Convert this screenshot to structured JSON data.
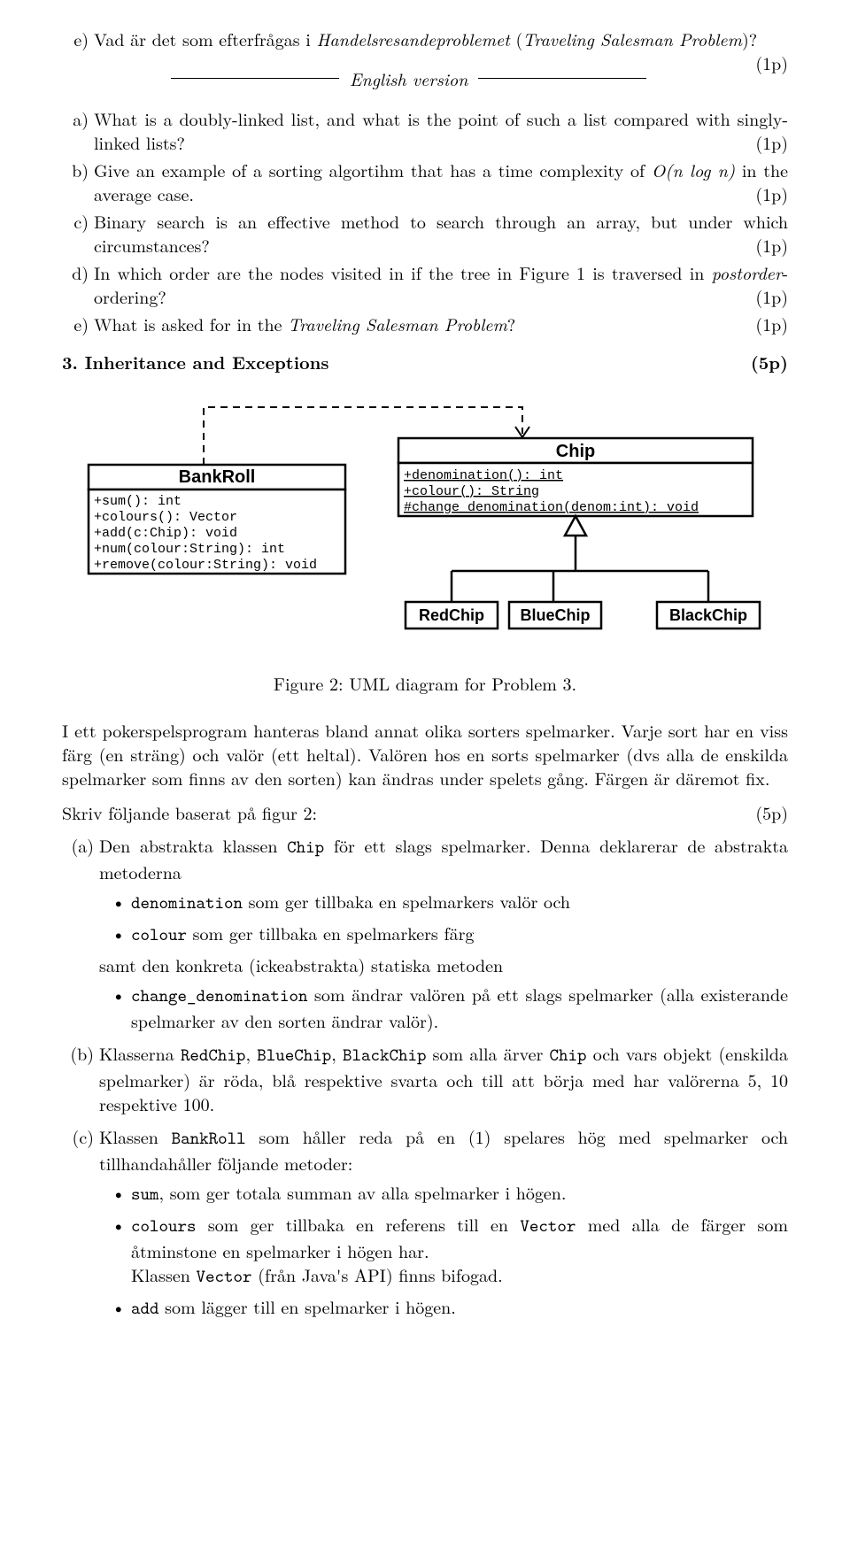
{
  "top_e": {
    "label": "e)",
    "text_a": "Vad är det som efterfrågas i ",
    "text_i": "Handelsresandeproblemet",
    "text_open": " (",
    "text_i2": "Traveling Salesman Problem",
    "text_close": ")?",
    "pts": "(1p)"
  },
  "english_version": "English version",
  "items": {
    "a": {
      "label": "a)",
      "text": "What is a doubly-linked list, and what is the point of such a list compared with singly-linked lists?",
      "pts": "(1p)"
    },
    "b": {
      "label": "b)",
      "pre": "Give an example of a sorting algortihm that has a time complexity of ",
      "math_pre": "O",
      "math_mid": "(n log n)",
      "post": " in the average case.",
      "pts": "(1p)"
    },
    "c": {
      "label": "c)",
      "text": "Binary search is an effective method to search through an array, but under which circumstances?",
      "pts": "(1p)"
    },
    "d": {
      "label": "d)",
      "pre": "In which order are the nodes visited in if the tree in Figure 1 is traversed in ",
      "it": "postorder",
      "post": "-ordering?",
      "pts": "(1p)"
    },
    "e": {
      "label": "e)",
      "pre": "What is asked for in the ",
      "it": "Traveling Salesman Problem",
      "post": "?",
      "pts": "(1p)"
    }
  },
  "section": {
    "num": "3.",
    "title": "Inheritance and Exceptions",
    "pts": "(5p)"
  },
  "uml": {
    "bankroll": {
      "title": "BankRoll",
      "ops": [
        "+sum(): int",
        "+colours(): Vector",
        "+add(c:Chip): void",
        "+num(colour:String): int",
        "+remove(colour:String): void"
      ]
    },
    "chip": {
      "title": "Chip",
      "ops": [
        "+denomination(): int",
        "+colour(): String",
        "#change_denomination(denom:int): void"
      ]
    },
    "red": "RedChip",
    "blue": "BlueChip",
    "black": "BlackChip"
  },
  "fig_caption": "Figure 2: UML diagram for Problem 3.",
  "para1": "I ett pokerspelsprogram hanteras bland annat olika sorters spelmarker. Varje sort har en viss färg (en sträng) och valör (ett heltal). Valören hos en sorts spelmarker (dvs alla de enskilda spelmarker som finns av den sorten) kan ändras under spelets gång. Färgen är däremot fix.",
  "para2": {
    "text": "Skriv följande baserat på figur 2:",
    "pts": "(5p)"
  },
  "sub": {
    "a": {
      "label": "(a)",
      "line1_pre": "Den abstrakta klassen ",
      "line1_code": "Chip",
      "line1_post": " för ett slags spelmarker.  Denna deklarerar de abstrakta metoderna",
      "b1_code": "denomination",
      "b1_text": " som ger tillbaka en spelmarkers valör och",
      "b2_code": "colour",
      "b2_text": " som ger tillbaka en spelmarkers färg",
      "mid": "samt den konkreta (ickeabstrakta) statiska metoden",
      "b3_code": "change_denomination",
      "b3_text": " som ändrar valören på ett slags spelmarker (alla existerande spelmarker av den sorten ändrar valör)."
    },
    "b": {
      "label": "(b)",
      "pre": "Klasserna ",
      "c1": "RedChip",
      "sep1": ", ",
      "c2": "BlueChip",
      "sep2": ", ",
      "c3": "BlackChip",
      "mid": " som alla ärver ",
      "c4": "Chip",
      "post": " och vars objekt (enskilda spelmarker) är röda, blå respektive svarta och till att börja med har valörerna 5, 10 respektive 100."
    },
    "c": {
      "label": "(c)",
      "pre": "Klassen ",
      "c1": "BankRoll",
      "post": " som håller reda på en (1) spelares hög med spelmarker och tillhandahåller följande metoder:",
      "b1_code": "sum",
      "b1_text": ", som ger totala summan av alla spelmarker i högen.",
      "b2_code": "colours",
      "b2_mid": " som ger tillbaka en referens till en ",
      "b2_code2": "Vector",
      "b2_post": " med alla de färger som åtminstone en spelmarker i högen har.",
      "b2_line2_pre": "Klassen ",
      "b2_line2_code": "Vector",
      "b2_line2_post": " (från Java's API) finns bifogad.",
      "b3_code": "add",
      "b3_text": " som lägger till en spelmarker i högen."
    }
  }
}
